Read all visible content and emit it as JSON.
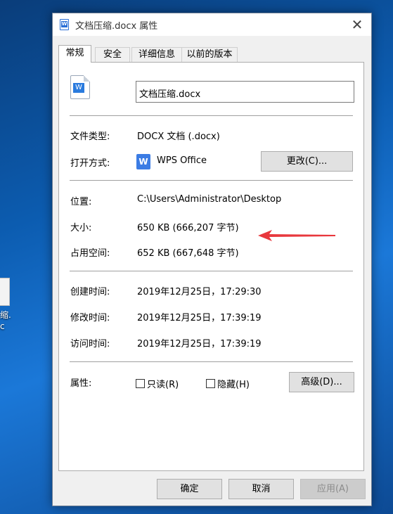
{
  "desktop": {
    "icon_label_line1": "缩.",
    "icon_label_line2": "c"
  },
  "dialog": {
    "title": "文档压缩.docx 属性",
    "close_symbol": "✕"
  },
  "tabs": [
    {
      "label": "常规"
    },
    {
      "label": "安全"
    },
    {
      "label": "详细信息"
    },
    {
      "label": "以前的版本"
    }
  ],
  "general": {
    "file_name": "文档压缩.docx",
    "type_label": "文件类型:",
    "type_value": "DOCX 文档 (.docx)",
    "opens_with_label": "打开方式:",
    "opens_with_value": "WPS Office",
    "change_button": "更改(C)...",
    "location_label": "位置:",
    "location_value": "C:\\Users\\Administrator\\Desktop",
    "size_label": "大小:",
    "size_value": "650 KB (666,207 字节)",
    "size_on_disk_label": "占用空间:",
    "size_on_disk_value": "652 KB (667,648 字节)",
    "created_label": "创建时间:",
    "created_value": "2019年12月25日，17:29:30",
    "modified_label": "修改时间:",
    "modified_value": "2019年12月25日，17:39:19",
    "accessed_label": "访问时间:",
    "accessed_value": "2019年12月25日，17:39:19",
    "attributes_label": "属性:",
    "readonly_label": "只读(R)",
    "hidden_label": "隐藏(H)",
    "advanced_button": "高级(D)..."
  },
  "footer": {
    "ok": "确定",
    "cancel": "取消",
    "apply": "应用(A)"
  },
  "colors": {
    "annotation_arrow": "#e8383d",
    "accent": "#2a7bde"
  }
}
